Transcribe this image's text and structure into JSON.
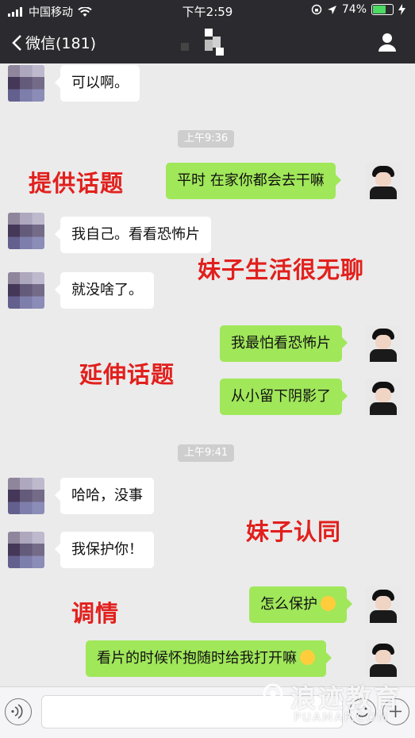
{
  "status_bar": {
    "carrier": "中国移动",
    "time": "下午2:59",
    "battery_percent": "74%",
    "battery_level": 0.74,
    "icons": [
      "signal-icon",
      "wifi-icon",
      "orientation-lock-icon",
      "location-icon",
      "battery-icon",
      "charging-icon"
    ]
  },
  "nav": {
    "back_label": "微信(181)",
    "back_icon": "chevron-left-icon",
    "title_icon": "pixelated-title",
    "right_icon": "person-icon"
  },
  "colors": {
    "header_bg": "#2b2b2f",
    "chat_bg": "#ebebeb",
    "my_bubble": "#a0e75a",
    "their_bubble": "#ffffff",
    "annotation_red": "#e1201d"
  },
  "messages": {
    "m1": "可以啊。",
    "t1": "上午9:36",
    "m2": "平时 在家你都会去干嘛",
    "m3": "我自己。看看恐怖片",
    "m4": "就没啥了。",
    "m5": "我最怕看恐怖片",
    "m6": "从小留下阴影了",
    "t2": "上午9:41",
    "m7": "哈哈，没事",
    "m8": "我保护你！",
    "m9": "怎么保护",
    "m10": "看片的时候怀抱随时给我打开嘛"
  },
  "annotations": {
    "a1": "提供话题",
    "a2": "妹子生活很无聊",
    "a3": "延伸话题",
    "a4": "妹子认同",
    "a5": "调情"
  },
  "input_bar": {
    "icons": [
      "voice-icon",
      "emoji-icon",
      "plus-icon"
    ]
  },
  "watermark": {
    "main": "浪迹教育",
    "sub": "PUAMAP.COM"
  }
}
